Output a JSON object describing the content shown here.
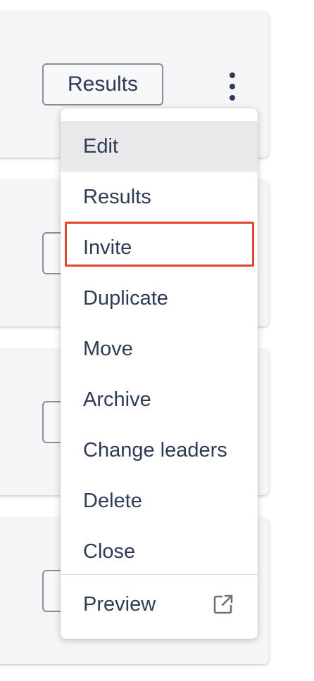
{
  "card_top": {
    "results_label": "Results"
  },
  "menu": {
    "items": [
      {
        "label": "Edit"
      },
      {
        "label": "Results"
      },
      {
        "label": "Invite"
      },
      {
        "label": "Duplicate"
      },
      {
        "label": "Move"
      },
      {
        "label": "Archive"
      },
      {
        "label": "Change leaders"
      },
      {
        "label": "Delete"
      },
      {
        "label": "Close"
      }
    ],
    "preview": {
      "label": "Preview",
      "icon": "external-link-icon"
    }
  },
  "colors": {
    "text": "#2d3b55",
    "highlight": "#e0452d",
    "active_bg": "#e9e9ec"
  }
}
